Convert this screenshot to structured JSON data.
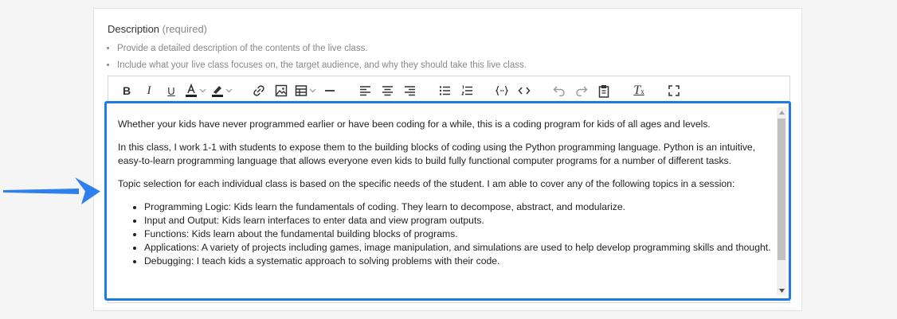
{
  "field": {
    "label": "Description",
    "required": "(required)",
    "hints": [
      "Provide a detailed description of the contents of the live class.",
      "Include what your live class focuses on, the target audience, and why they should take this live class."
    ]
  },
  "toolbar": {
    "bold": "B",
    "italic": "I",
    "underline": "U",
    "clear_format": "T"
  },
  "content": {
    "paragraphs": [
      "Whether your kids have never programmed earlier or have been coding for a while, this is a coding program for kids of all ages and levels.",
      "In this class, I work 1-1 with students to expose them to the building blocks of coding using the Python programming language. Python is an intuitive, easy-to-learn programming language that allows everyone even kids to build fully functional computer programs for a number of different tasks.",
      "Topic selection for each individual class is based on the specific needs of the student. I am able to cover any of the following topics in a session:"
    ],
    "topics": [
      "Programming Logic: Kids learn the fundamentals of coding. They learn to decompose, abstract, and modularize.",
      "Input and Output: Kids learn interfaces to enter data and view program outputs.",
      "Functions: Kids learn about the fundamental building blocks of programs.",
      "Applications: A variety of projects including games, image manipulation, and simulations are used to help develop programming skills and thought.",
      "Debugging: I teach kids a systematic approach to solving problems with their code."
    ]
  },
  "colors": {
    "focus_border": "#1f7ae8",
    "arrow": "#2f80ed"
  }
}
